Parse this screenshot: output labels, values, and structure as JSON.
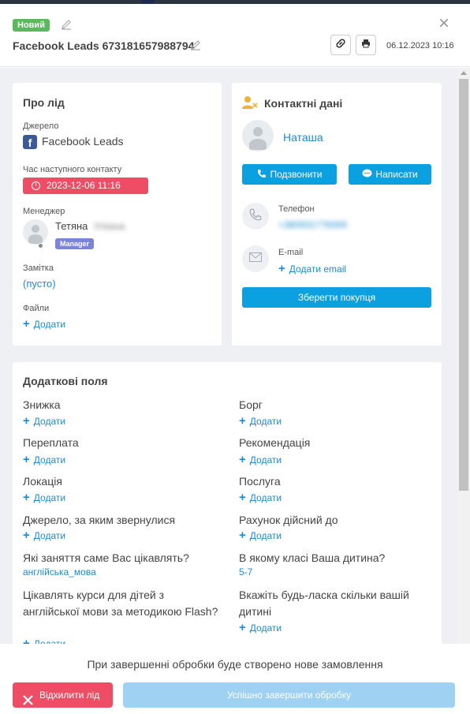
{
  "header": {
    "status_badge": "Новий",
    "title": "Facebook Leads 673181657988794",
    "date": "06.12.2023 10:16"
  },
  "about": {
    "title": "Про лід",
    "source_label": "Джерело",
    "source_value": "Facebook Leads",
    "next_contact_label": "Час наступного контакту",
    "next_contact_value": "2023-12-06 11:16",
    "manager_label": "Менеджер",
    "manager_name": "Тетяна",
    "manager_surname": "Уліана",
    "manager_role": "Manager",
    "note_label": "Замітка",
    "note_value": "(пусто)",
    "files_label": "Файли",
    "files_add": "Додати"
  },
  "contacts": {
    "title": "Контактні дані",
    "contact_name": "Наташа",
    "call_button": "Подзвонити",
    "write_button": "Написати",
    "phone_label": "Телефон",
    "phone_value": "+380931776000",
    "email_label": "E-mail",
    "email_add": "Додати email",
    "save_buyer_button": "Зберегти покупця"
  },
  "extra": {
    "title": "Додаткові поля",
    "fields": [
      {
        "label": "Знижка",
        "value": "Додати"
      },
      {
        "label": "Борг",
        "value": "Додати"
      },
      {
        "label": "Переплата",
        "value": "Додати"
      },
      {
        "label": "Рекомендація",
        "value": "Додати"
      },
      {
        "label": "Локація",
        "value": "Додати"
      },
      {
        "label": "Послуга",
        "value": "Додати"
      },
      {
        "label": "Джерело, за яким звернулися",
        "value": "Додати"
      },
      {
        "label": "Рахунок дійсний до",
        "value": "Додати"
      },
      {
        "label": "Які заняття саме Вас цікавлять?",
        "value": "англійська_мова"
      },
      {
        "label": "В якому класі Ваша дитина?",
        "value": "5-7"
      },
      {
        "label": "Цікавлять курси для дітей з англійської мови за методикою Flash?",
        "value": "Додати"
      },
      {
        "label": "Вкажіть будь-ласка скільки вашій дитині",
        "value": "Додати"
      }
    ]
  },
  "footer": {
    "note": "При завершенні обробки буде створено нове замовлення",
    "reject_button": "Відхилити лід",
    "success_button": "Успішно завершити обробку"
  },
  "colors": {
    "accent": "#0ba0e0",
    "danger": "#ee4d66",
    "success_badge": "#5cb85c",
    "link": "#1a8bd0"
  }
}
